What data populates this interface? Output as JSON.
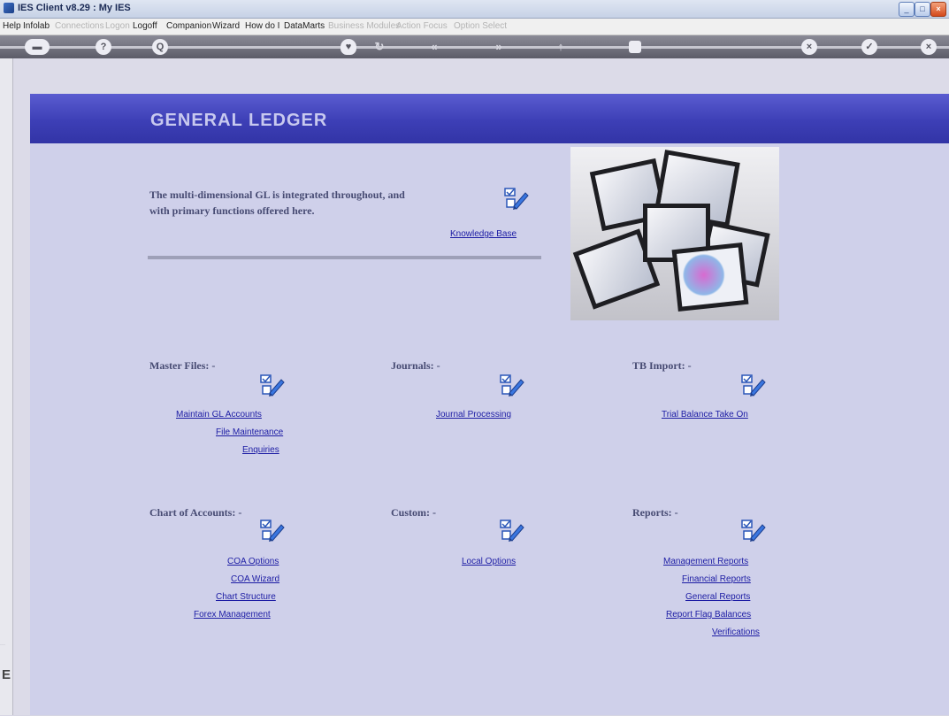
{
  "window": {
    "title": "IES Client v8.29 : My IES"
  },
  "menu": [
    {
      "label": "Help",
      "enabled": true
    },
    {
      "label": "Infolab",
      "enabled": true
    },
    {
      "label": "Connections",
      "enabled": false
    },
    {
      "label": "Logon",
      "enabled": false
    },
    {
      "label": "Logoff",
      "enabled": true
    },
    {
      "label": "Companion",
      "enabled": true
    },
    {
      "label": "Wizard",
      "enabled": true
    },
    {
      "label": "How do I",
      "enabled": true
    },
    {
      "label": "DataMarts",
      "enabled": true
    },
    {
      "label": "Business Modules",
      "enabled": false
    },
    {
      "label": "Action Focus",
      "enabled": false
    },
    {
      "label": "Option Select",
      "enabled": false
    }
  ],
  "toolbar": {
    "help": "?",
    "search": "Q",
    "back": "«",
    "forward": "»",
    "cancel": "×",
    "ok": "✓",
    "close": "×",
    "nav": "▬"
  },
  "page": {
    "title": "GENERAL LEDGER",
    "intro": "The multi-dimensional GL is integrated throughout, and with primary functions offered here.",
    "knowledge_base": "Knowledge Base"
  },
  "sections": {
    "master_files": {
      "title": "Master Files: -",
      "links": [
        "Maintain GL Accounts",
        "File Maintenance",
        "Enquiries"
      ]
    },
    "journals": {
      "title": "Journals: -",
      "links": [
        "Journal Processing"
      ]
    },
    "tb_import": {
      "title": "TB Import: -",
      "links": [
        "Trial Balance Take On"
      ]
    },
    "chart_of_accounts": {
      "title": "Chart of Accounts: -",
      "links": [
        "COA Options",
        "COA Wizard",
        "Chart Structure",
        "Forex Management"
      ]
    },
    "custom": {
      "title": "Custom: -",
      "links": [
        "Local Options"
      ]
    },
    "reports": {
      "title": "Reports: -",
      "links": [
        "Management Reports",
        "Financial Reports",
        "General Reports",
        "Report Flag Balances",
        "Verifications"
      ]
    }
  },
  "sidebar": {
    "glyph": "E"
  },
  "colors": {
    "header_band": "#3d3fb6",
    "panel": "#cfd0ea",
    "link": "#1c1ca4",
    "section_text": "#474b73"
  }
}
